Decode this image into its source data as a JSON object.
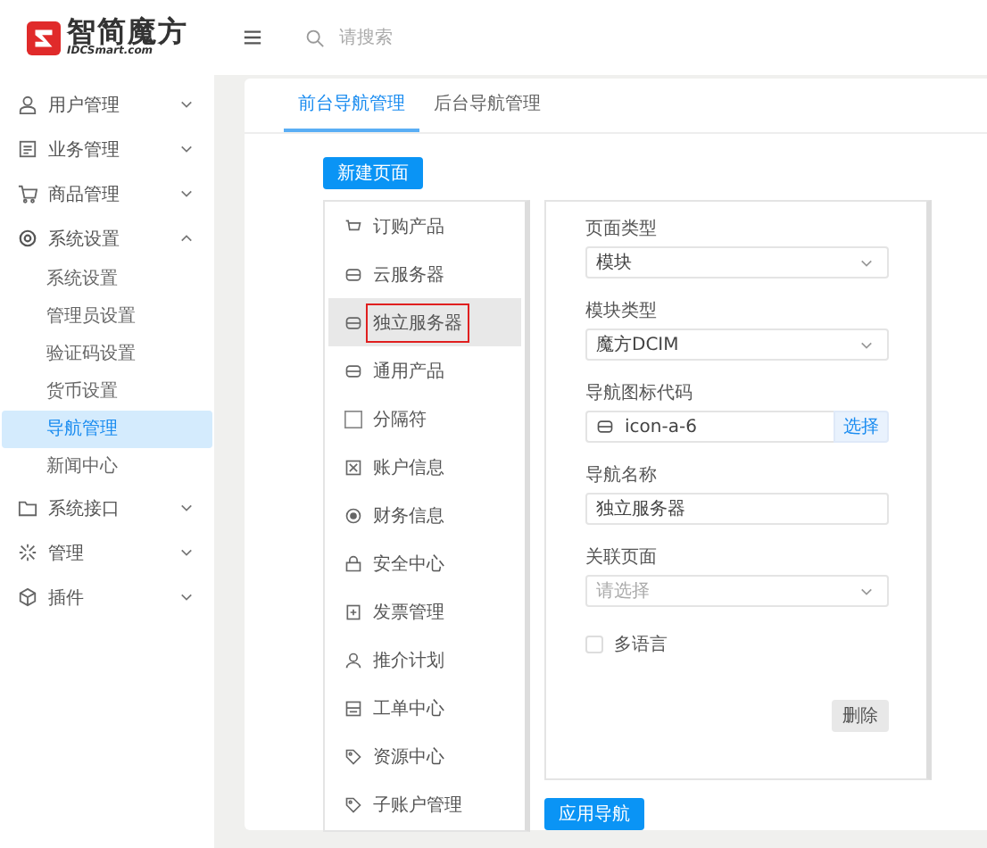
{
  "header": {
    "logo_text": "智简魔方",
    "logo_subtext": "IDCSmart.com",
    "search": {
      "placeholder": "请搜索"
    }
  },
  "sidebar": {
    "items": [
      {
        "label": "用户管理",
        "expanded": false,
        "selected": false
      },
      {
        "label": "业务管理",
        "expanded": false,
        "selected": false
      },
      {
        "label": "商品管理",
        "expanded": false,
        "selected": false
      },
      {
        "label": "系统设置",
        "expanded": true,
        "selected": false,
        "children": [
          {
            "label": "系统设置",
            "selected": false
          },
          {
            "label": "管理员设置",
            "selected": false
          },
          {
            "label": "验证码设置",
            "selected": false
          },
          {
            "label": "货币设置",
            "selected": false
          },
          {
            "label": "导航管理",
            "selected": true
          },
          {
            "label": "新闻中心",
            "selected": false
          }
        ]
      },
      {
        "label": "系统接口",
        "expanded": false,
        "selected": false
      },
      {
        "label": "管理",
        "expanded": false,
        "selected": false
      },
      {
        "label": "插件",
        "expanded": false,
        "selected": false
      }
    ]
  },
  "tabs": [
    {
      "label": "前台导航管理",
      "selected": true
    },
    {
      "label": "后台导航管理",
      "selected": false
    }
  ],
  "new_page_button": "新建页面",
  "nav_items": [
    {
      "label": "订购产品",
      "selected": false
    },
    {
      "label": "云服务器",
      "selected": false
    },
    {
      "label": "独立服务器",
      "selected": true
    },
    {
      "label": "通用产品",
      "selected": false
    },
    {
      "label": "分隔符",
      "selected": false
    },
    {
      "label": "账户信息",
      "selected": false
    },
    {
      "label": "财务信息",
      "selected": false
    },
    {
      "label": "安全中心",
      "selected": false
    },
    {
      "label": "发票管理",
      "selected": false
    },
    {
      "label": "推介计划",
      "selected": false
    },
    {
      "label": "工单中心",
      "selected": false
    },
    {
      "label": "资源中心",
      "selected": false
    },
    {
      "label": "子账户管理",
      "selected": false
    }
  ],
  "form": {
    "fields": [
      {
        "kind": "select",
        "label": "页面类型",
        "value": "模块"
      },
      {
        "kind": "select",
        "label": "模块类型",
        "value": "魔方DCIM"
      },
      {
        "kind": "icon-input",
        "label": "导航图标代码",
        "value": "icon-a-6",
        "button": "选择"
      },
      {
        "kind": "text",
        "label": "导航名称",
        "value": "独立服务器"
      },
      {
        "kind": "select",
        "label": "关联页面",
        "placeholder": "请选择"
      },
      {
        "kind": "checkbox",
        "label": "多语言",
        "checked": false
      }
    ],
    "delete_button": "删除"
  },
  "apply_button": "应用导航"
}
